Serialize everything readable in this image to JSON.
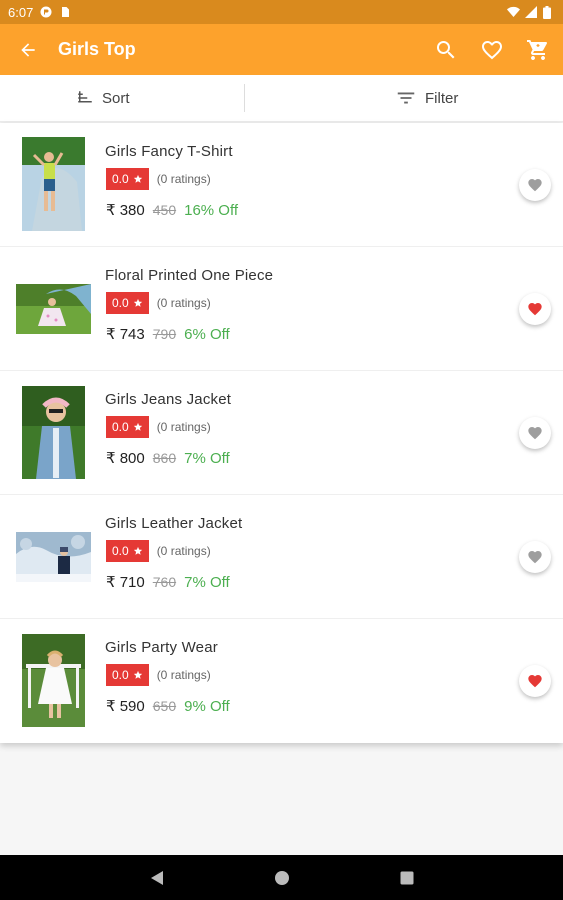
{
  "status_bar": {
    "time": "6:07"
  },
  "app_bar": {
    "title": "Girls Top"
  },
  "toolbar": {
    "sort_label": "Sort",
    "filter_label": "Filter"
  },
  "products": [
    {
      "name": "Girls Fancy T-Shirt",
      "rating": "0.0",
      "rating_count": "(0 ratings)",
      "price": "₹ 380",
      "mrp": "450",
      "discount": "16% Off",
      "favorited": false
    },
    {
      "name": "Floral Printed One Piece",
      "rating": "0.0",
      "rating_count": "(0 ratings)",
      "price": "₹ 743",
      "mrp": "790",
      "discount": "6% Off",
      "favorited": true
    },
    {
      "name": "Girls Jeans Jacket",
      "rating": "0.0",
      "rating_count": "(0 ratings)",
      "price": "₹ 800",
      "mrp": "860",
      "discount": "7% Off",
      "favorited": false
    },
    {
      "name": "Girls Leather Jacket",
      "rating": "0.0",
      "rating_count": "(0 ratings)",
      "price": "₹ 710",
      "mrp": "760",
      "discount": "7% Off",
      "favorited": false
    },
    {
      "name": "Girls Party Wear",
      "rating": "0.0",
      "rating_count": "(0 ratings)",
      "price": "₹ 590",
      "mrp": "650",
      "discount": "9% Off",
      "favorited": true
    }
  ],
  "colors": {
    "accent": "#fda22c",
    "status_bar": "#d98a1e",
    "rating_badge": "#e53935",
    "discount": "#4caf50",
    "fav_active": "#e53935",
    "fav_inactive": "#9e9e9e"
  }
}
